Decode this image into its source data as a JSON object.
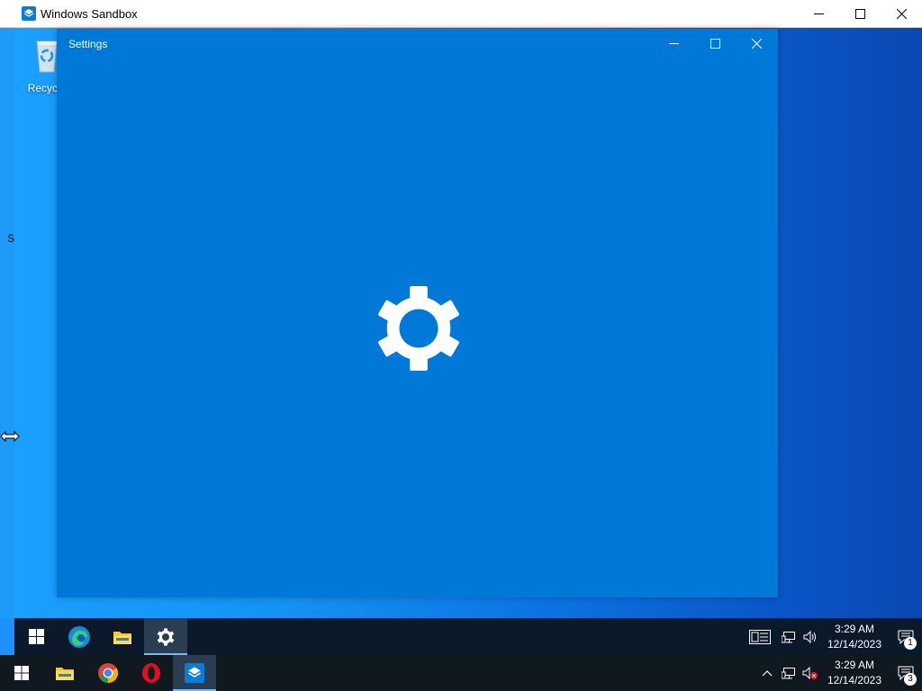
{
  "sandbox_window": {
    "title": "Windows Sandbox",
    "controls": [
      "minimize",
      "maximize",
      "close"
    ]
  },
  "desktop": {
    "recycle_bin_label": "Recycle",
    "stray_text": "S"
  },
  "settings_window": {
    "title": "Settings",
    "splash_icon": "gear-icon",
    "background_color": "#0078d7"
  },
  "sandbox_taskbar": {
    "apps": [
      {
        "name": "start",
        "icon": "windows-logo-icon"
      },
      {
        "name": "edge",
        "icon": "edge-icon"
      },
      {
        "name": "file-explorer",
        "icon": "folder-icon"
      },
      {
        "name": "settings",
        "icon": "gear-icon",
        "active": true
      }
    ],
    "clock": {
      "time": "3:29 AM",
      "date": "12/14/2023"
    },
    "notification_count": "1"
  },
  "host_taskbar": {
    "apps": [
      {
        "name": "start",
        "icon": "windows-logo-icon"
      },
      {
        "name": "file-explorer",
        "icon": "folder-icon"
      },
      {
        "name": "chrome",
        "icon": "chrome-icon"
      },
      {
        "name": "opera",
        "icon": "opera-icon"
      },
      {
        "name": "windows-sandbox",
        "icon": "sandbox-icon",
        "active": true
      }
    ],
    "clock": {
      "time": "3:29 AM",
      "date": "12/14/2023"
    },
    "notification_count": "3"
  },
  "colors": {
    "accent": "#0078d7",
    "taskbar": "#101820",
    "sandbox_taskbar": "#0b1a2b"
  }
}
